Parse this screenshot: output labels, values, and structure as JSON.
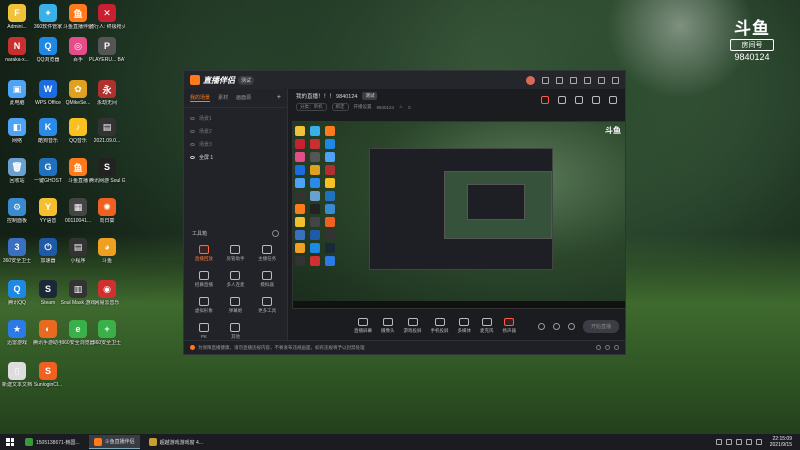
{
  "desktop": {
    "icons": [
      {
        "label": "Admini...",
        "color": "#f0c23a",
        "glyph": "F"
      },
      {
        "label": "360软件管家",
        "color": "#3ab0e8",
        "glyph": "✦"
      },
      {
        "label": "斗鱼直播伴侣",
        "color": "#ff7a1a",
        "glyph": "鱼"
      },
      {
        "label": "骑行人: 终极枪火版",
        "color": "#c82030",
        "glyph": "✕"
      },
      {
        "label": "naraka-x...",
        "color": "#c83030",
        "glyph": "N"
      },
      {
        "label": "QQ浏览器",
        "color": "#1e88e5",
        "glyph": "Q"
      },
      {
        "label": "百手",
        "color": "#e44d8a",
        "glyph": "◎"
      },
      {
        "label": "PLAYERU... BATTLEGR...",
        "color": "#555",
        "glyph": "P"
      },
      {
        "label": "此电脑",
        "color": "#4fa3f7",
        "glyph": "▣"
      },
      {
        "label": "WPS Office",
        "color": "#1b6ce0",
        "glyph": "W"
      },
      {
        "label": "QMikeSe...",
        "color": "#e0a020",
        "glyph": "✿"
      },
      {
        "label": "永劫无间",
        "color": "#b03030",
        "glyph": "永"
      },
      {
        "label": "网络",
        "color": "#4fa3f7",
        "glyph": "◧"
      },
      {
        "label": "酷狗音乐",
        "color": "#2b8ae8",
        "glyph": "K"
      },
      {
        "label": "QQ音乐",
        "color": "#f8c020",
        "glyph": "♪"
      },
      {
        "label": "2021.09.0...",
        "color": "#333",
        "glyph": "▤"
      },
      {
        "label": "回收站",
        "color": "#6aa0d0",
        "glyph": "🗑"
      },
      {
        "label": "一键GHOST",
        "color": "#2070c0",
        "glyph": "G"
      },
      {
        "label": "斗鱼直播",
        "color": "#ff7a1a",
        "glyph": "鱼"
      },
      {
        "label": "腾讯网游 Soul G...",
        "color": "#222",
        "glyph": "S"
      },
      {
        "label": "控制面板",
        "color": "#3a8ad0",
        "glyph": "⚙"
      },
      {
        "label": "YY语音",
        "color": "#f5c030",
        "glyph": "Y"
      },
      {
        "label": "00110041...",
        "color": "#444",
        "glyph": "▦"
      },
      {
        "label": "向日葵",
        "color": "#f06020",
        "glyph": "✺"
      },
      {
        "label": "360安全卫士",
        "color": "#3a70c0",
        "glyph": "3"
      },
      {
        "label": "加速器",
        "color": "#1e5aa8",
        "glyph": "⏻"
      },
      {
        "label": "小程序",
        "color": "#333",
        "glyph": "▤"
      },
      {
        "label": "斗鱼",
        "color": "#f0a020",
        "glyph": "◕"
      },
      {
        "label": "腾讯QQ",
        "color": "#1e88e5",
        "glyph": "Q"
      },
      {
        "label": "Steam",
        "color": "#1b2838",
        "glyph": "S"
      },
      {
        "label": "Soul Mask 游戏",
        "color": "#333",
        "glyph": "▥"
      },
      {
        "label": "网易云音乐",
        "color": "#d03030",
        "glyph": "◉"
      },
      {
        "label": "迅雷游戏",
        "color": "#2a7ae8",
        "glyph": "★"
      },
      {
        "label": "腾讯手游助手",
        "color": "#e86a20",
        "glyph": "◐"
      },
      {
        "label": "360安全浏览器",
        "color": "#3ab04a",
        "glyph": "e"
      },
      {
        "label": "360安全卫士",
        "color": "#3ab04a",
        "glyph": "+"
      },
      {
        "label": "新建文本文档",
        "color": "#ddd",
        "glyph": "▯"
      },
      {
        "label": "SunloginCl...",
        "color": "#f06020",
        "glyph": "S"
      }
    ]
  },
  "watermark": {
    "logo": "斗鱼",
    "sub": "房间号",
    "room": "9840124"
  },
  "app": {
    "name": "直播伴侣",
    "version": "测试",
    "left_tabs": [
      "我的场景",
      "素材",
      "画面源"
    ],
    "scenes": [
      "场景1",
      "场景2",
      "场景3",
      "全屏 1"
    ],
    "toolbox_title": "工具箱",
    "tools": [
      "直播回放",
      "房管助手",
      "主播任务",
      "招募直播",
      "多人连麦",
      "模拟器",
      "虚拟形象",
      "弹幕姬",
      "更多工具",
      "PK",
      "其他"
    ],
    "room_title": "我的直播！！！ 9840124",
    "room_badge": "测试",
    "room_row2": [
      "分类：单机",
      "绑定",
      "开播设置",
      "9840124",
      "0"
    ],
    "actions": [
      "直播屏幕",
      "摄像头",
      "游戏投屏",
      "手机投屏",
      "多媒体",
      "麦克风",
      "扬声器"
    ],
    "start_label": "开始直播",
    "notice": "为保障直播健康，请勿直播违规内容，不要发布违规画面，如有违规将予以封禁处理"
  },
  "taskbar": {
    "apps": [
      "1505138671-韩国...",
      "斗鱼直播伴侣",
      "超越游戏游戏窗 4..."
    ],
    "time": "22:15:09",
    "date": "2021/9/15"
  }
}
